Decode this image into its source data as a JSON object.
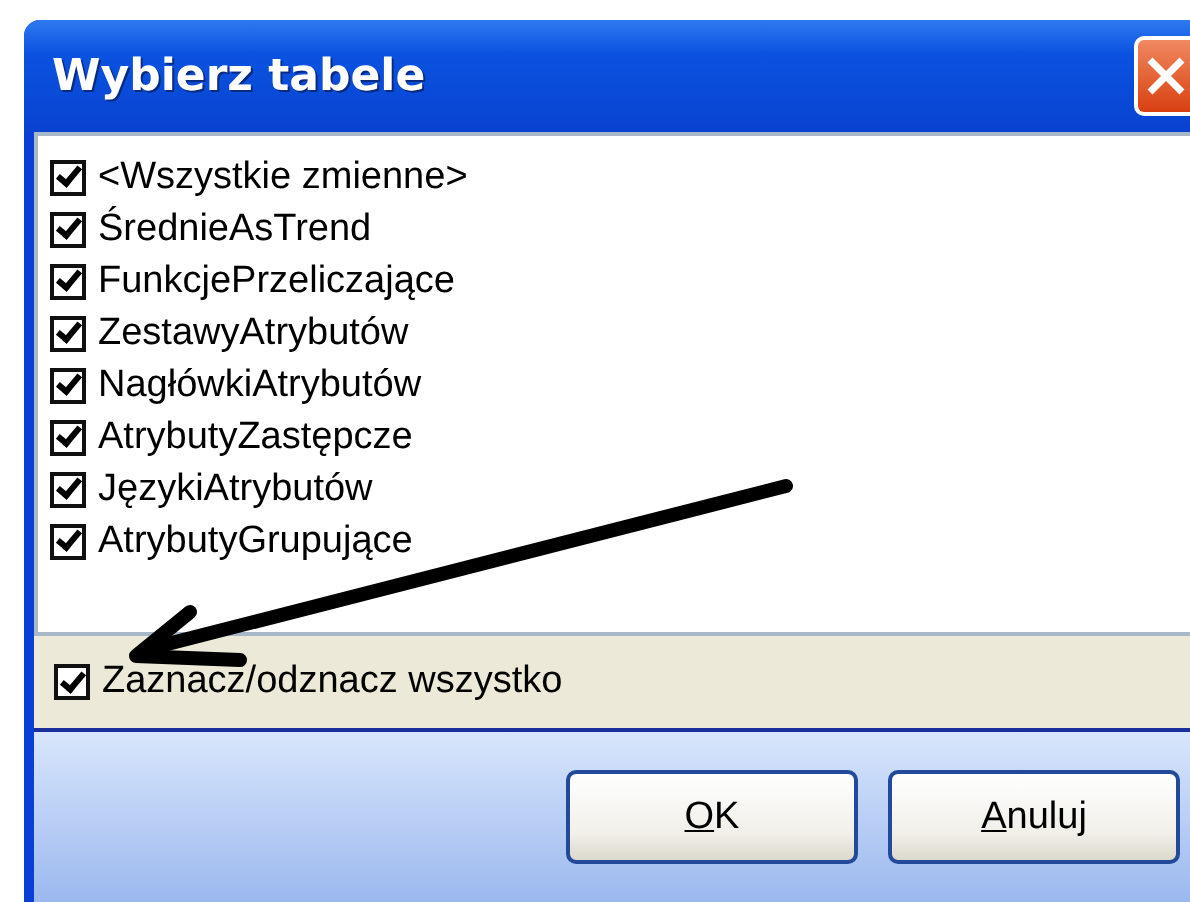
{
  "window": {
    "title": "Wybierz tabele"
  },
  "tables": [
    {
      "label": "<Wszystkie zmienne>",
      "checked": true
    },
    {
      "label": "ŚrednieAsTrend",
      "checked": true
    },
    {
      "label": "FunkcjePrzeliczające",
      "checked": true
    },
    {
      "label": "ZestawyAtrybutów",
      "checked": true
    },
    {
      "label": "NagłówkiAtrybutów",
      "checked": true
    },
    {
      "label": "AtrybutyZastępcze",
      "checked": true
    },
    {
      "label": "JęzykiAtrybutów",
      "checked": true
    },
    {
      "label": "AtrybutyGrupujące",
      "checked": true
    }
  ],
  "select_all": {
    "label": "Zaznacz/odznacz wszystko",
    "checked": true
  },
  "buttons": [
    {
      "label": "OK"
    },
    {
      "label": "Anuluj"
    }
  ]
}
